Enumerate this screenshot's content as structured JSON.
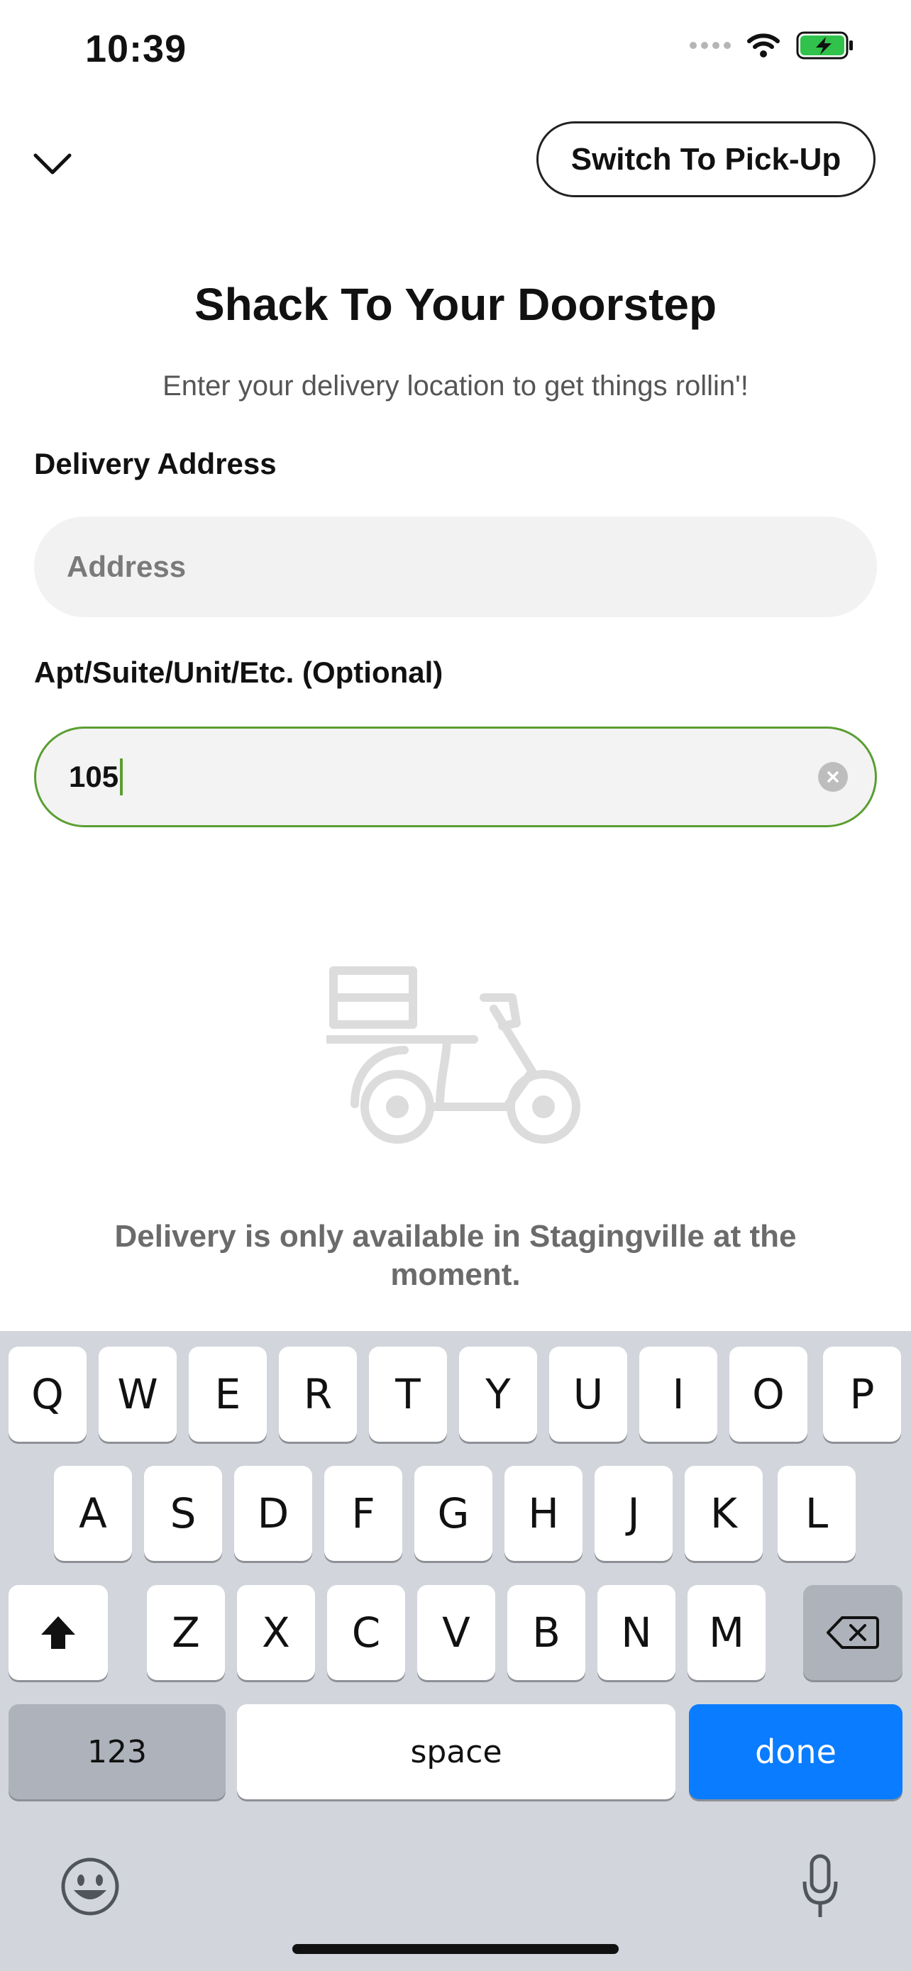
{
  "status_bar": {
    "time": "10:39"
  },
  "header": {
    "switch_label": "Switch To Pick-Up"
  },
  "title": "Shack To Your Doorstep",
  "subtitle": "Enter your delivery location to get things rollin'!",
  "form": {
    "address_label": "Delivery Address",
    "address_placeholder": "Address",
    "apt_label": "Apt/Suite/Unit/Etc. (Optional)",
    "apt_value": "105"
  },
  "notice": "Delivery is only available in Stagingville at the moment.",
  "keyboard": {
    "row1": [
      "Q",
      "W",
      "E",
      "R",
      "T",
      "Y",
      "U",
      "I",
      "O",
      "P"
    ],
    "row2": [
      "A",
      "S",
      "D",
      "F",
      "G",
      "H",
      "J",
      "K",
      "L"
    ],
    "row3": [
      "Z",
      "X",
      "C",
      "V",
      "B",
      "N",
      "M"
    ],
    "numbers_label": "123",
    "space_label": "space",
    "done_label": "done"
  },
  "colors": {
    "accent_green": "#5a9e32",
    "done_blue": "#0a7cff"
  }
}
